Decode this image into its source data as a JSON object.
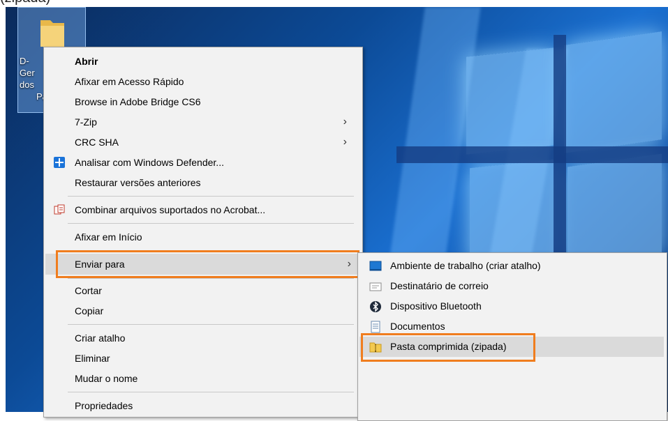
{
  "caption": "(zipada)",
  "desktop_icon": {
    "label_lines": [
      "D-",
      "Ger",
      "dos",
      "Pa"
    ]
  },
  "context_menu": {
    "items": [
      {
        "label": "Abrir",
        "bold": true
      },
      {
        "label": "Afixar em Acesso Rápido"
      },
      {
        "label": "Browse in Adobe Bridge CS6"
      },
      {
        "label": "7-Zip",
        "submenu": true
      },
      {
        "label": "CRC SHA",
        "submenu": true
      },
      {
        "label": "Analisar com Windows Defender...",
        "icon": "windows-defender-icon"
      },
      {
        "label": "Restaurar versões anteriores"
      },
      {
        "label": "Combinar arquivos suportados no Acrobat...",
        "icon": "acrobat-icon"
      },
      {
        "label": "Afixar em Início"
      },
      {
        "label": "Enviar para",
        "submenu": true,
        "highlighted": true
      },
      {
        "label": "Cortar"
      },
      {
        "label": "Copiar"
      },
      {
        "label": "Criar atalho"
      },
      {
        "label": "Eliminar"
      },
      {
        "label": "Mudar o nome"
      },
      {
        "label": "Propriedades"
      }
    ],
    "arrow_glyph": "›"
  },
  "send_to_submenu": {
    "items": [
      {
        "label": "Ambiente de trabalho (criar atalho)",
        "icon": "desktop-icon"
      },
      {
        "label": "Destinatário de correio",
        "icon": "mail-icon"
      },
      {
        "label": "Dispositivo Bluetooth",
        "icon": "bluetooth-icon"
      },
      {
        "label": "Documentos",
        "icon": "documents-icon"
      },
      {
        "label": "Pasta comprimida (zipada)",
        "icon": "zip-folder-icon",
        "highlighted": true
      }
    ]
  },
  "colors": {
    "highlight_box": "#f07d1e",
    "menu_bg": "#f2f2f2",
    "hover_bg": "#dadada"
  }
}
